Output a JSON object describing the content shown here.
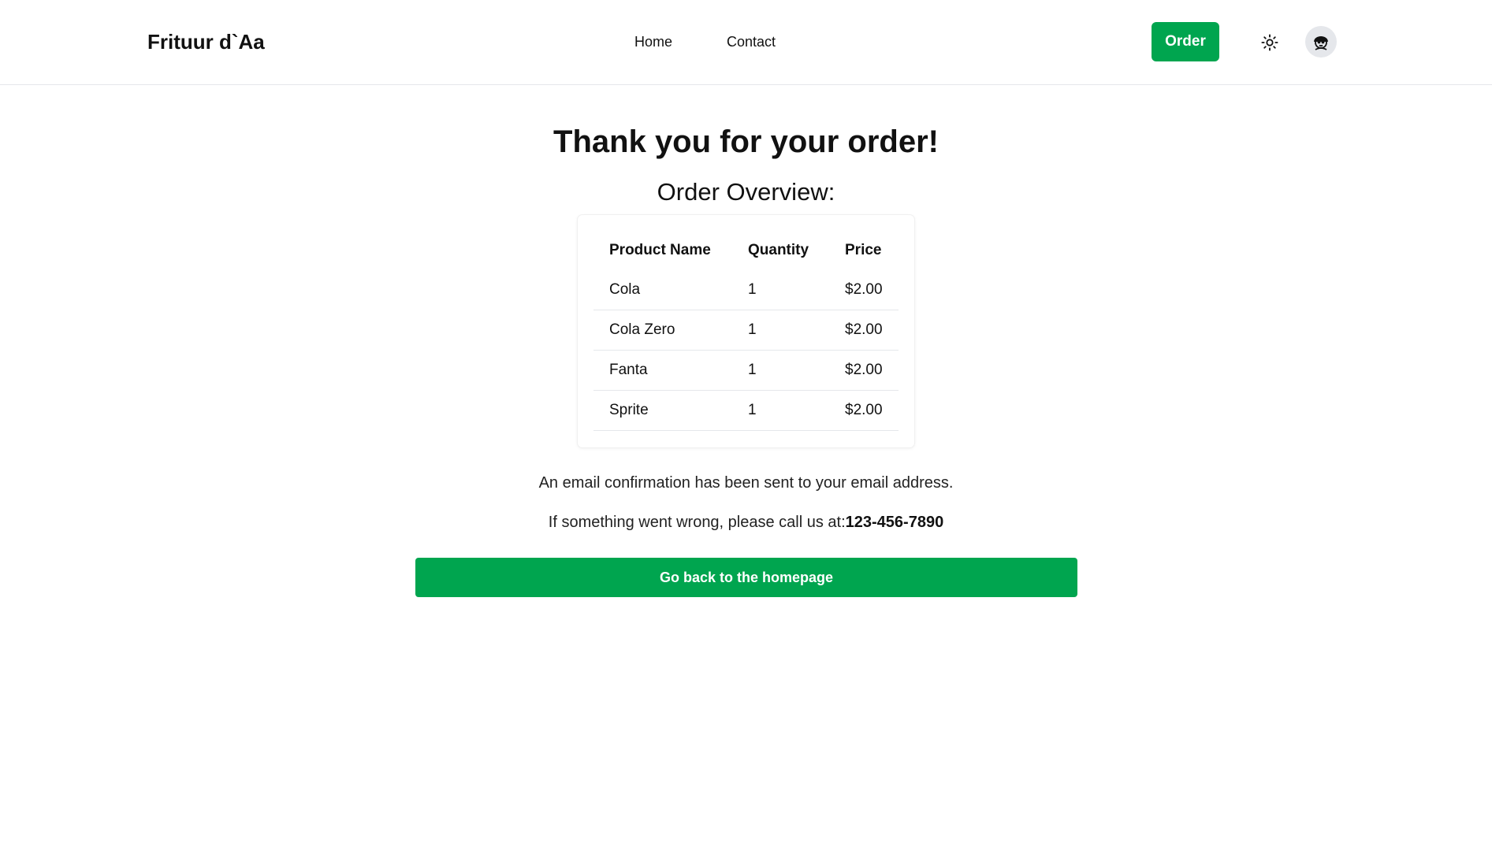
{
  "header": {
    "brand": "Frituur d`Aa",
    "nav": [
      {
        "label": "Home"
      },
      {
        "label": "Contact"
      }
    ],
    "order_label": "Order",
    "theme_icon": "sun-icon",
    "avatar_icon": "user-avatar-icon"
  },
  "main": {
    "title": "Thank you for your order!",
    "subtitle": "Order Overview:",
    "table": {
      "headers": [
        "Product Name",
        "Quantity",
        "Price"
      ],
      "rows": [
        [
          "Cola",
          "1",
          "$2.00"
        ],
        [
          "Cola Zero",
          "1",
          "$2.00"
        ],
        [
          "Fanta",
          "1",
          "$2.00"
        ],
        [
          "Sprite",
          "1",
          "$2.00"
        ]
      ]
    },
    "email_notice": "An email confirmation has been sent to your email address.",
    "call_notice": "If something went wrong, please call us at:",
    "phone": "123-456-7890",
    "home_button": "Go back to the homepage"
  },
  "colors": {
    "accent": "#00a54f",
    "border": "#e5e7eb"
  }
}
